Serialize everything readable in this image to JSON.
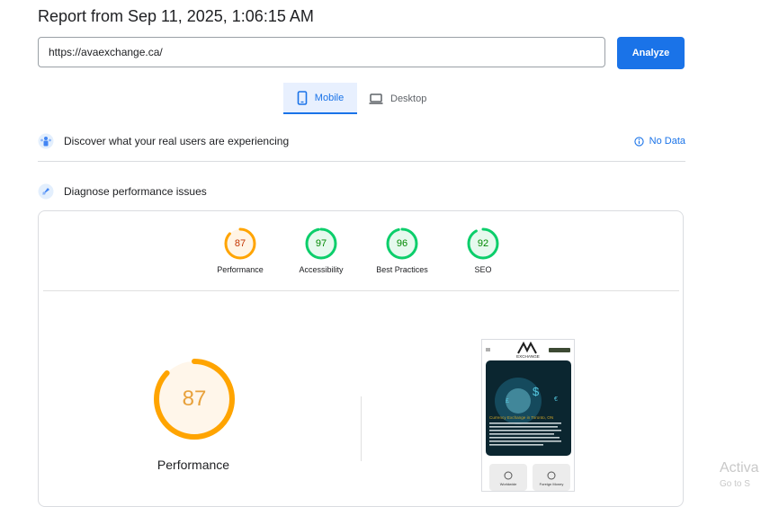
{
  "header": {
    "title": "Report from Sep 11, 2025, 1:06:15 AM"
  },
  "search": {
    "url_value": "https://avaexchange.ca/",
    "analyze_label": "Analyze"
  },
  "device_tabs": {
    "mobile_label": "Mobile",
    "desktop_label": "Desktop",
    "selected": "Mobile"
  },
  "field_data": {
    "label": "Discover what your real users are experiencing",
    "status": "No Data"
  },
  "lab_data": {
    "label": "Diagnose performance issues"
  },
  "scores": [
    {
      "name": "Performance",
      "value": "87",
      "color": "#ffa400"
    },
    {
      "name": "Accessibility",
      "value": "97",
      "color": "#0cce6b"
    },
    {
      "name": "Best Practices",
      "value": "96",
      "color": "#0cce6b"
    },
    {
      "name": "SEO",
      "value": "92",
      "color": "#0cce6b"
    }
  ],
  "main_score": {
    "name": "Performance",
    "value": "87",
    "color": "#ffa400"
  },
  "screenshot": {
    "brand_line": "EXCHANGE",
    "hero_title": "Currency Exchange in Toronto, ON",
    "tile_1": "Worldwide",
    "tile_2": "Foreign Money"
  },
  "watermark": {
    "line1": "Activa",
    "line2": "Go to S"
  }
}
